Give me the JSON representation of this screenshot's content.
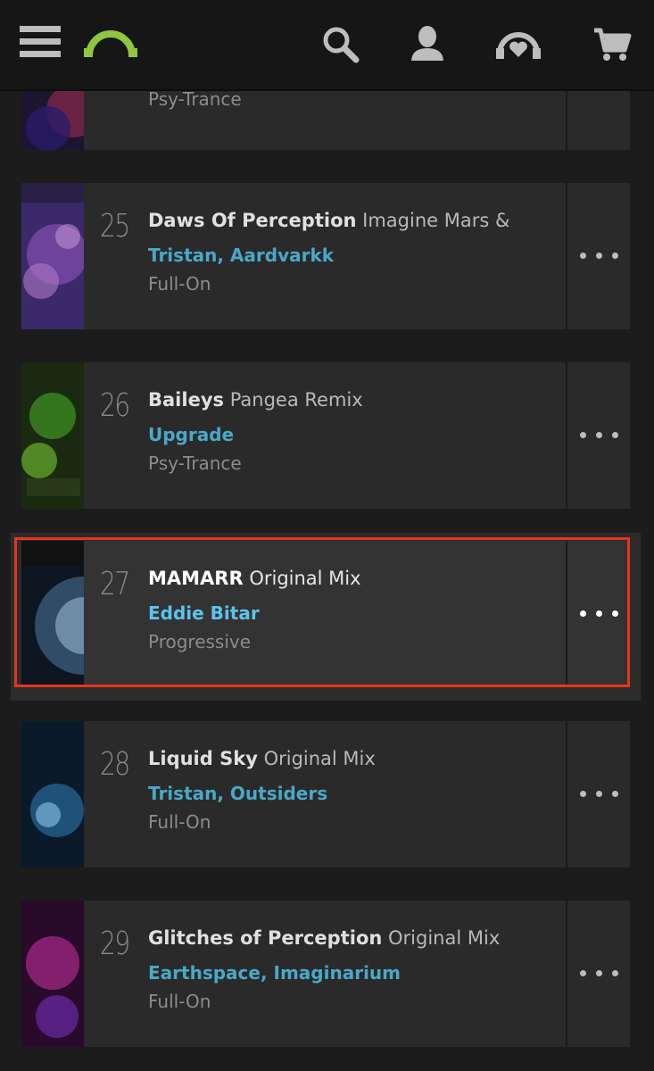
{
  "header": {
    "icons": [
      "menu-icon",
      "beatport-logo",
      "search-icon",
      "account-icon",
      "my-beatport-icon",
      "cart-icon"
    ],
    "accent_color": "#8dc63f"
  },
  "tracks": [
    {
      "number": "",
      "title": "",
      "mix": "",
      "artists": "",
      "genre": "Psy-Trance"
    },
    {
      "number": "25",
      "title": "Daws Of Perception",
      "mix": "Imagine Mars &",
      "artists": "Tristan, Aardvarkk",
      "genre": "Full-On"
    },
    {
      "number": "26",
      "title": "Baileys",
      "mix": "Pangea Remix",
      "artists": "Upgrade",
      "genre": "Psy-Trance"
    },
    {
      "number": "27",
      "title": "MAMARR",
      "mix": "Original Mix",
      "artists": "Eddie Bitar",
      "genre": "Progressive"
    },
    {
      "number": "28",
      "title": "Liquid Sky",
      "mix": "Original Mix",
      "artists": "Tristan, Outsiders",
      "genre": "Full-On"
    },
    {
      "number": "29",
      "title": "Glitches of Perception",
      "mix": "Original Mix",
      "artists": "Earthspace, Imaginarium",
      "genre": "Full-On"
    }
  ],
  "highlight_color": "#e8341c",
  "selected_track": "27"
}
